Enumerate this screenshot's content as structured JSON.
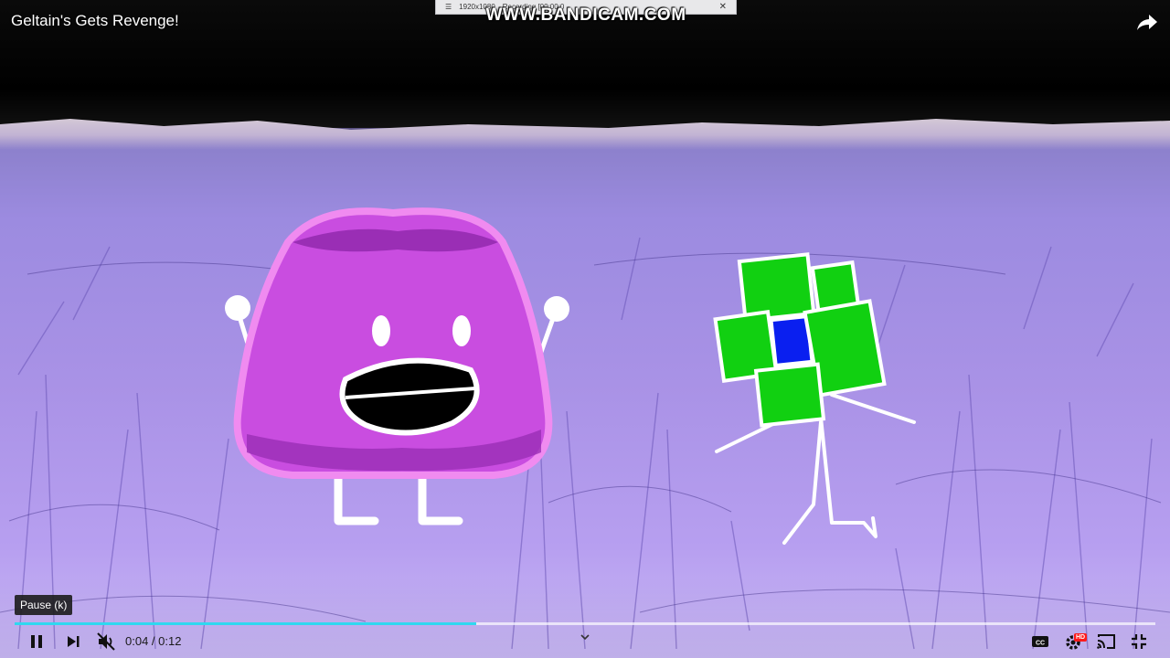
{
  "video": {
    "title": "Geltain's Gets Revenge!"
  },
  "overlay": {
    "recorder_logo": "WWW.BANDICAM.COM",
    "recorder_resolution": "1920x1080",
    "recorder_status": "Recording [00:00:0"
  },
  "player": {
    "tooltip": "Pause (k)",
    "current_time": "0:04",
    "duration": "0:12",
    "time_separator": " / ",
    "progress_played": 0.405,
    "progress_loaded": 1.0,
    "accent_color": "#2fd8f0"
  },
  "icons": {
    "share": "share-icon",
    "pause": "pause-icon",
    "next": "next-icon",
    "mute": "volume-muted-icon",
    "chevron": "chevron-down-icon",
    "cc": "cc-icon",
    "settings": "settings-icon",
    "cast": "cast-icon",
    "fullscreen": "exit-fullscreen-icon"
  },
  "badges": {
    "hd": "HD"
  }
}
